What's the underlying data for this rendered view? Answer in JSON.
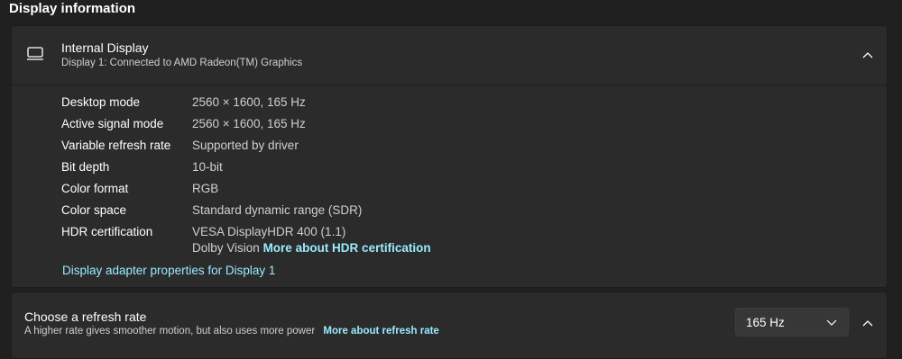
{
  "section": {
    "title": "Display information"
  },
  "display_card": {
    "title": "Internal Display",
    "subtitle": "Display 1: Connected to AMD Radeon(TM) Graphics",
    "icon": "monitor-icon",
    "expanded": true,
    "rows": [
      {
        "label": "Desktop mode",
        "value": "2560 × 1600, 165 Hz"
      },
      {
        "label": "Active signal mode",
        "value": "2560 × 1600, 165 Hz"
      },
      {
        "label": "Variable refresh rate",
        "value": "Supported by driver"
      },
      {
        "label": "Bit depth",
        "value": "10-bit"
      },
      {
        "label": "Color format",
        "value": "RGB"
      },
      {
        "label": "Color space",
        "value": "Standard dynamic range (SDR)"
      },
      {
        "label": "HDR certification",
        "value": "VESA DisplayHDR 400 (1.1)",
        "value2": "Dolby Vision",
        "link": "More about HDR certification"
      }
    ],
    "adapter_link": "Display adapter properties for Display 1"
  },
  "refresh_card": {
    "title": "Choose a refresh rate",
    "description": "A higher rate gives smoother motion, but also uses more power",
    "link": "More about refresh rate",
    "selected": "165 Hz"
  },
  "colors": {
    "background": "#202020",
    "card": "#2b2b2b",
    "link": "#99ebff",
    "text": "#ffffff",
    "secondary_text": "#cfcfcf"
  }
}
